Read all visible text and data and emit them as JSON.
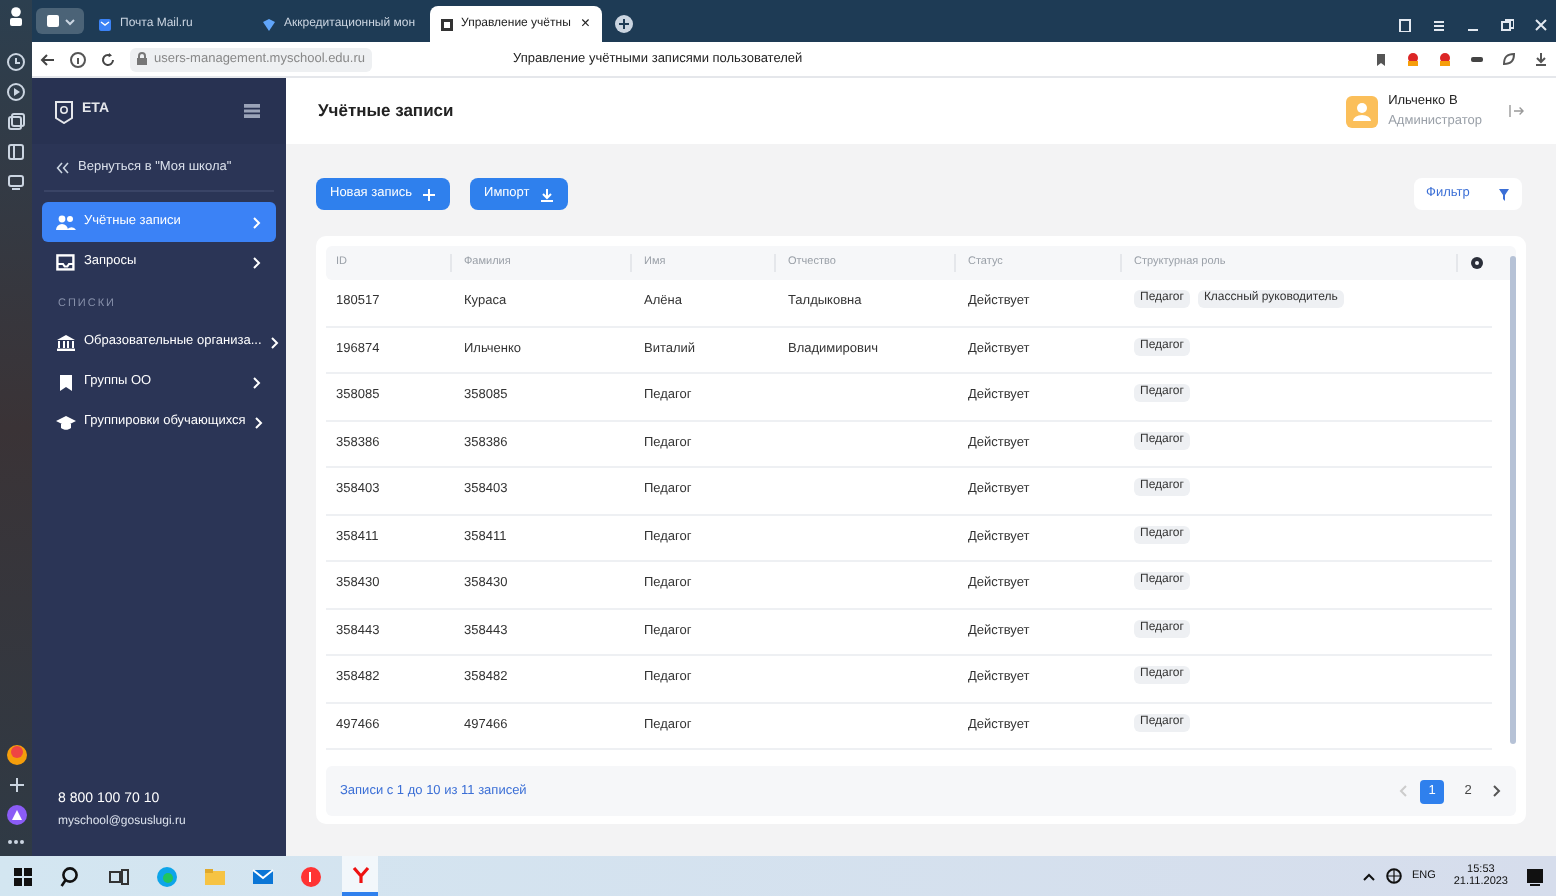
{
  "browser": {
    "tabs": [
      {
        "title": "Почта Mail.ru",
        "selected": false
      },
      {
        "title": "Аккредитационный мон",
        "selected": false
      },
      {
        "title": "Управление учётны",
        "selected": true,
        "close": "×"
      }
    ],
    "url": "users-management.myschool.edu.ru",
    "page_title": "Управление учётными записями пользователей"
  },
  "sidebar": {
    "logo": "ЕТА",
    "back_link": "Вернуться в \"Моя школа\"",
    "items": [
      {
        "label": "Учётные записи",
        "selected": true
      },
      {
        "label": "Запросы",
        "selected": false
      }
    ],
    "section": "СПИСКИ",
    "lists": [
      {
        "label": "Образовательные организа...",
        "selected": false
      },
      {
        "label": "Группы ОО",
        "selected": false
      },
      {
        "label": "Группировки обучающихся",
        "selected": false
      }
    ],
    "phone": "8 800 100 70 10",
    "email": "myschool@gosuslugi.ru"
  },
  "header": {
    "title": "Учётные записи",
    "user_name": "Ильченко В",
    "user_role": "Администратор"
  },
  "toolbar": {
    "new_button": "Новая запись",
    "import_button": "Импорт",
    "filter_button": "Фильтр"
  },
  "table": {
    "columns": [
      "ID",
      "Фамилия",
      "Имя",
      "Отчество",
      "Статус",
      "Структурная роль"
    ],
    "rows": [
      {
        "id": "180517",
        "surname": "Кураса",
        "name": "Алёна",
        "patronymic": "Талдыковна",
        "status": "Действует",
        "roles": [
          "Педагог",
          "Классный руководитель"
        ]
      },
      {
        "id": "196874",
        "surname": "Ильченко",
        "name": "Виталий",
        "patronymic": "Владимирович",
        "status": "Действует",
        "roles": [
          "Педагог"
        ]
      },
      {
        "id": "358085",
        "surname": "358085",
        "name": "Педагог",
        "status": "Действует",
        "roles": [
          "Педагог"
        ]
      },
      {
        "id": "358386",
        "surname": "358386",
        "name": "Педагог",
        "status": "Действует",
        "roles": [
          "Педагог"
        ]
      },
      {
        "id": "358403",
        "surname": "358403",
        "name": "Педагог",
        "status": "Действует",
        "roles": [
          "Педагог"
        ]
      },
      {
        "id": "358411",
        "surname": "358411",
        "name": "Педагог",
        "status": "Действует",
        "roles": [
          "Педагог"
        ]
      },
      {
        "id": "358430",
        "surname": "358430",
        "name": "Педагог",
        "status": "Действует",
        "roles": [
          "Педагог"
        ]
      },
      {
        "id": "358443",
        "surname": "358443",
        "name": "Педагог",
        "status": "Действует",
        "roles": [
          "Педагог"
        ]
      },
      {
        "id": "358482",
        "surname": "358482",
        "name": "Педагог",
        "status": "Действует",
        "roles": [
          "Педагог"
        ]
      },
      {
        "id": "497466",
        "surname": "497466",
        "name": "Педагог",
        "status": "Действует",
        "roles": [
          "Педагог"
        ]
      }
    ],
    "info": "Записи с 1 до 10 из 11 записей",
    "pages": [
      {
        "label": "1",
        "selected": true
      },
      {
        "label": "2",
        "selected": false
      }
    ]
  },
  "taskbar": {
    "language": "ENG",
    "time": "15:53",
    "date": "21.11.2023"
  }
}
